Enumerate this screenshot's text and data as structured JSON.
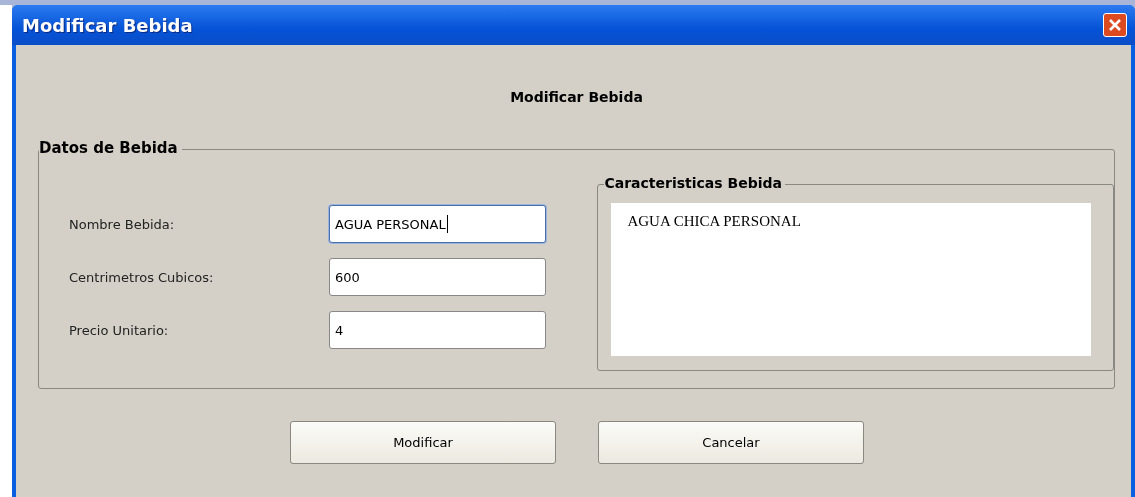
{
  "window": {
    "title": "Modificar Bebida"
  },
  "heading": "Modificar Bebida",
  "group": {
    "legend": "Datos de Bebida",
    "fields": [
      {
        "label": "Nombre Bebida:",
        "value": "AGUA PERSONAL",
        "focused": true
      },
      {
        "label": "Centrimetros Cubicos:",
        "value": "600",
        "focused": false
      },
      {
        "label": "Precio Unitario:",
        "value": "4",
        "focused": false
      }
    ],
    "details": {
      "legend": "Caracteristicas Bebida",
      "value": "AGUA CHICA PERSONAL"
    }
  },
  "buttons": [
    "Modificar",
    "Cancelar"
  ]
}
